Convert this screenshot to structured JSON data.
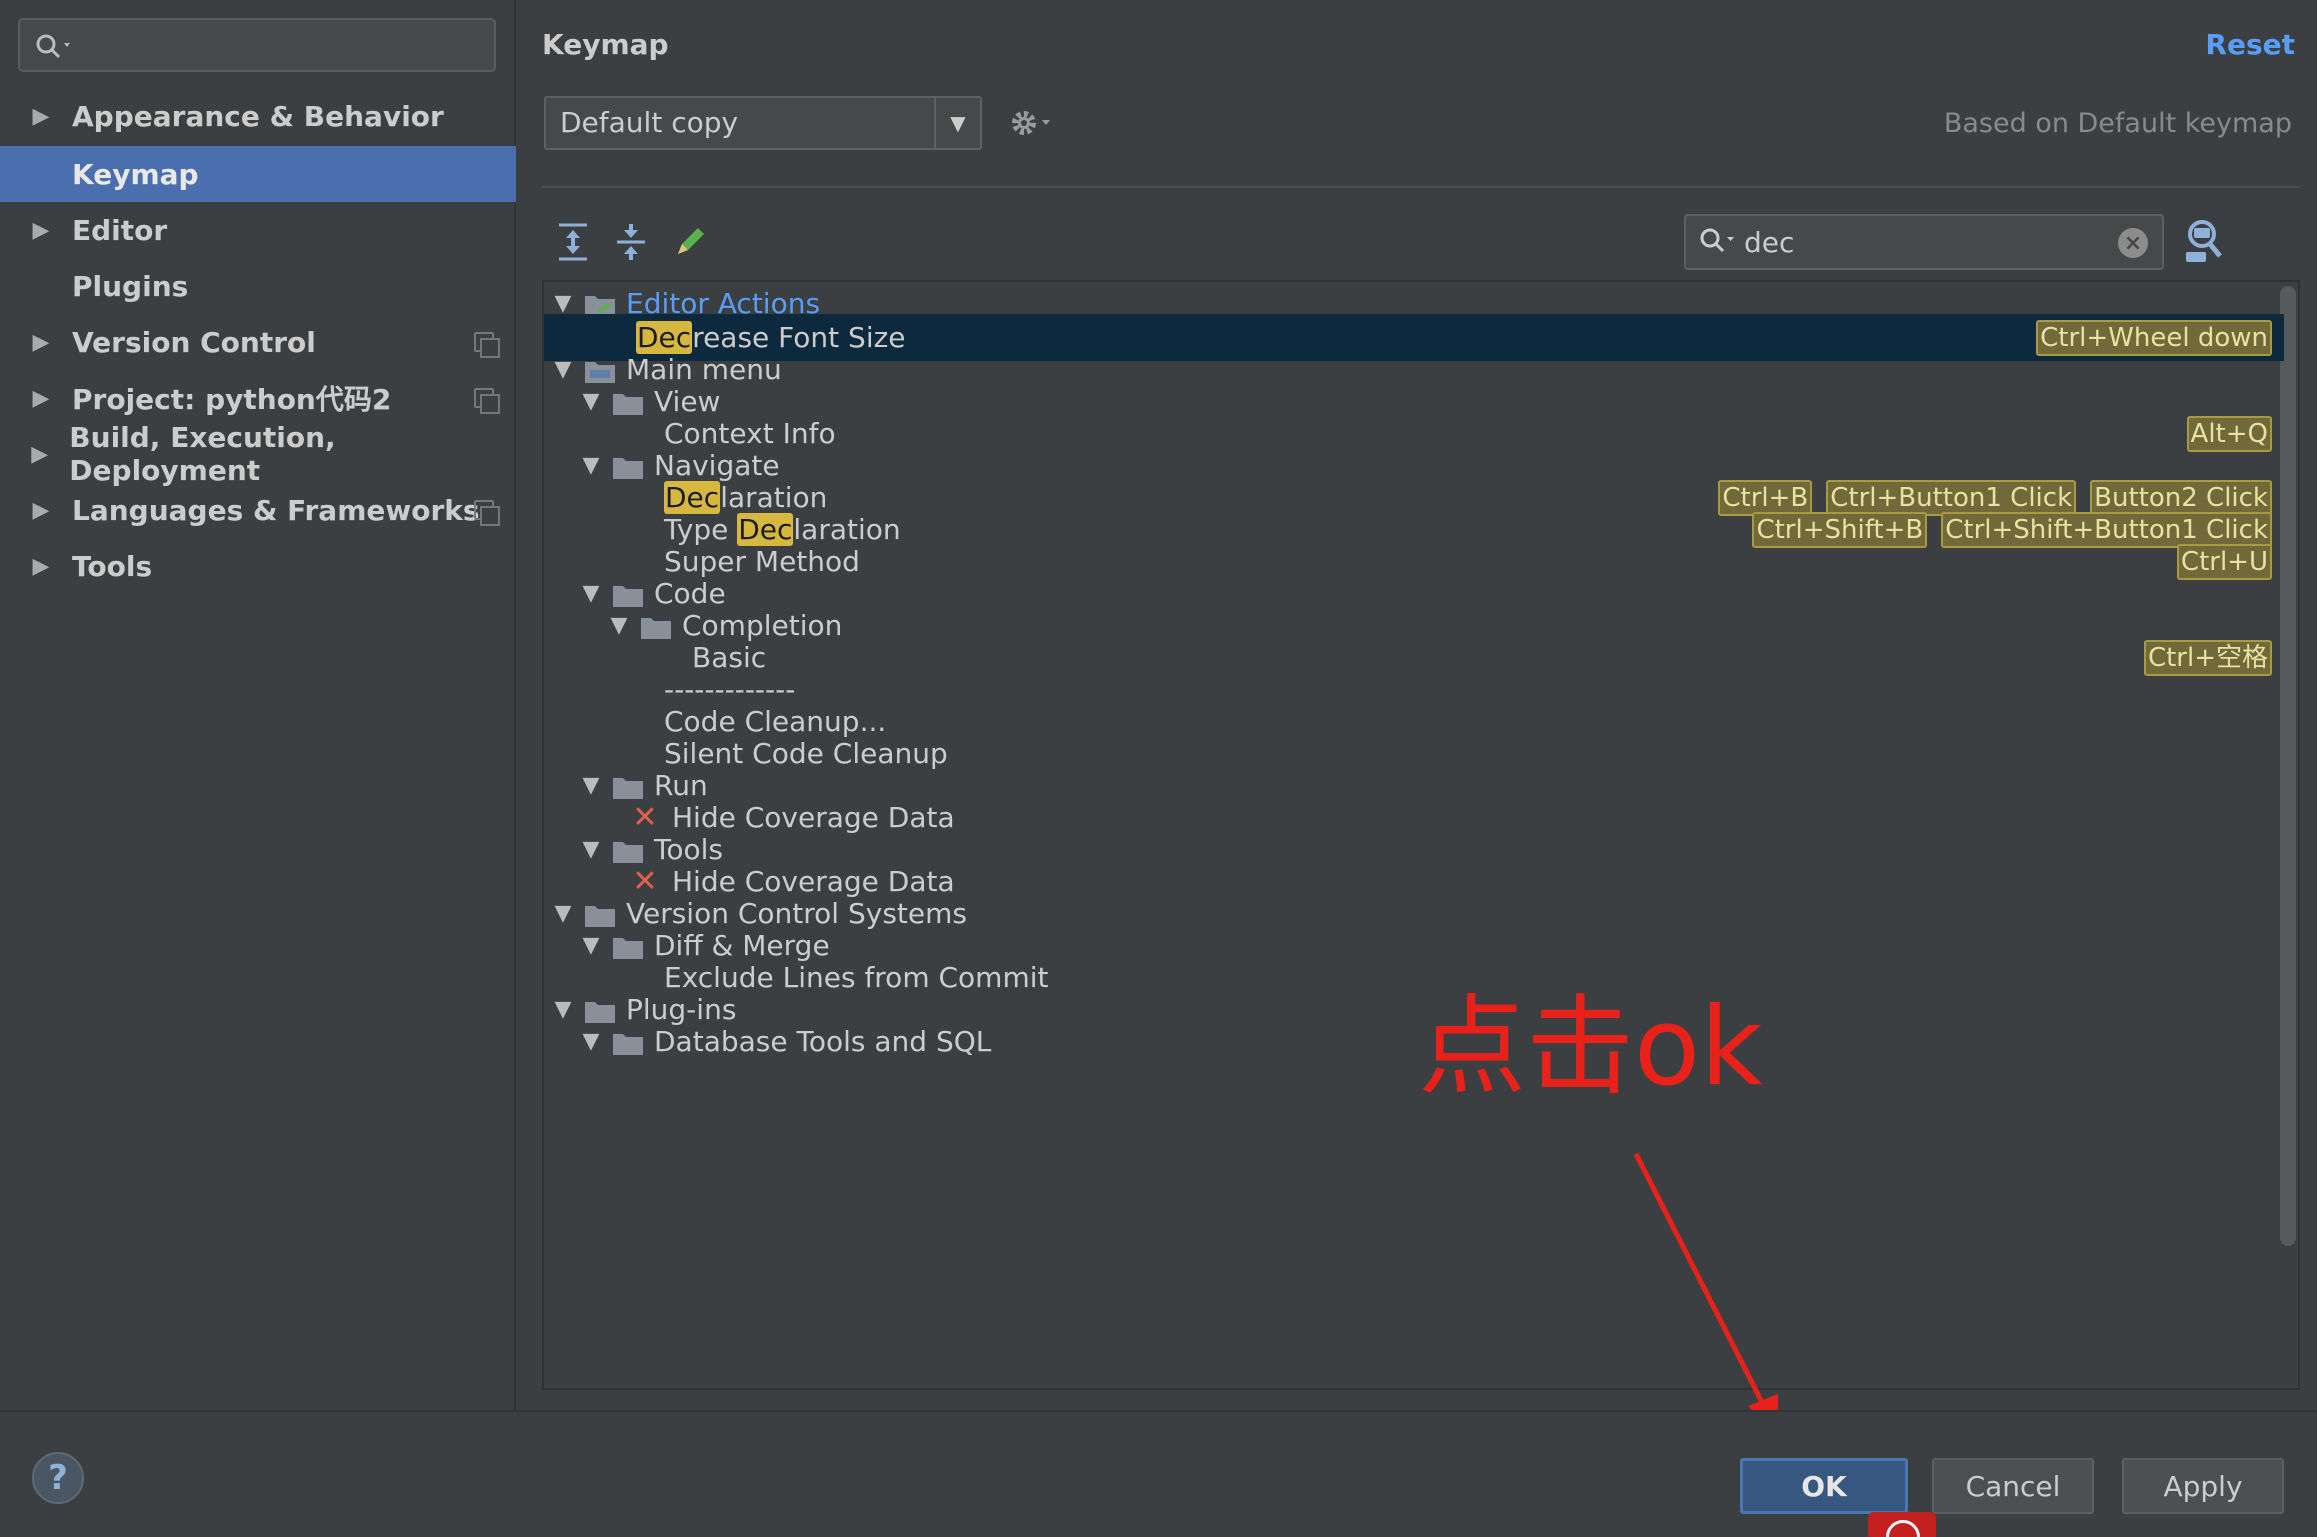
{
  "sidebar": {
    "search_placeholder": "",
    "items": [
      {
        "label": "Appearance & Behavior",
        "expandable": true
      },
      {
        "label": "Keymap",
        "expandable": false,
        "selected": true
      },
      {
        "label": "Editor",
        "expandable": true
      },
      {
        "label": "Plugins",
        "expandable": false
      },
      {
        "label": "Version Control",
        "expandable": true,
        "project_icon": true
      },
      {
        "label": "Project: python代码2",
        "expandable": true,
        "project_icon": true
      },
      {
        "label": "Build, Execution, Deployment",
        "expandable": true
      },
      {
        "label": "Languages & Frameworks",
        "expandable": true,
        "project_icon": true
      },
      {
        "label": "Tools",
        "expandable": true
      }
    ]
  },
  "main": {
    "title": "Keymap",
    "reset_label": "Reset",
    "keymap_value": "Default copy",
    "based_on": "Based on Default keymap",
    "filter_value": "dec",
    "icons": [
      "expand-all-icon",
      "collapse-all-icon",
      "edit-shortcut-icon",
      "gear-icon",
      "search-icon",
      "find-by-shortcut-icon",
      "clear-icon"
    ]
  },
  "tree": {
    "rows": {
      "r0": "Editor Actions",
      "r1_hl": "Dec",
      "r1_rest": "rease Font Size",
      "r1_s1": "Ctrl+Wheel down",
      "r2": "Main menu",
      "r3": "View",
      "r4": "Context Info",
      "r4_s1": "Alt+Q",
      "r5": "Navigate",
      "r6_hl": "Dec",
      "r6_rest": "laration",
      "r6_s1": "Ctrl+B",
      "r6_s2": "Ctrl+Button1 Click",
      "r6_s3": "Button2 Click",
      "r7_pre": "Type ",
      "r7_hl": "Dec",
      "r7_rest": "laration",
      "r7_s1": "Ctrl+Shift+B",
      "r7_s2": "Ctrl+Shift+Button1 Click",
      "r8": "Super Method",
      "r8_s1": "Ctrl+U",
      "r9": "Code",
      "r10": "Completion",
      "r11": "Basic",
      "r11_s1": "Ctrl+空格",
      "r12": "-------------",
      "r13": "Code Cleanup...",
      "r14": "Silent Code Cleanup",
      "r15": "Run",
      "r16": "Hide Coverage Data",
      "r17": "Tools",
      "r18": "Hide Coverage Data",
      "r19": "Version Control Systems",
      "r20": "Diff & Merge",
      "r21": "Exclude Lines from Commit",
      "r22": "Plug-ins",
      "r23": "Database Tools and SQL"
    }
  },
  "annotation": {
    "text": "点击ok",
    "color": "#e8221a"
  },
  "footer": {
    "help_label": "?",
    "ok_label": "OK",
    "cancel_label": "Cancel",
    "apply_label": "Apply"
  },
  "colors": {
    "accent": "#4b6eaf",
    "link": "#589df6",
    "highlight": "#d6b840",
    "selection": "#0d293e"
  }
}
